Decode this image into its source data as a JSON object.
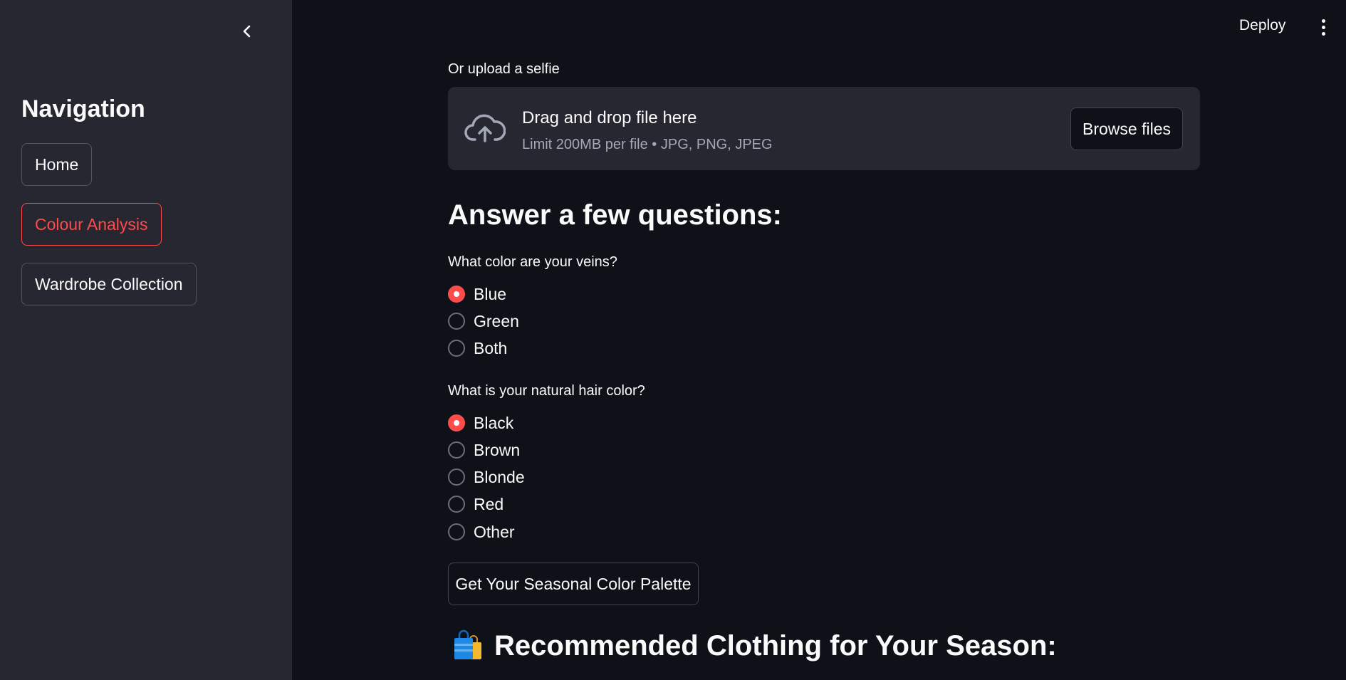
{
  "sidebar": {
    "title": "Navigation",
    "items": [
      {
        "label": "Home",
        "active": false
      },
      {
        "label": "Colour Analysis",
        "active": true
      },
      {
        "label": "Wardrobe Collection",
        "active": false
      }
    ],
    "collapse_icon": "chevron-left-icon"
  },
  "header": {
    "deploy_label": "Deploy",
    "menu_icon": "kebab-menu-icon"
  },
  "upload": {
    "label": "Or upload a selfie",
    "title": "Drag and drop file here",
    "subtitle": "Limit 200MB per file • JPG, PNG, JPEG",
    "browse_label": "Browse files",
    "icon": "cloud-upload-icon"
  },
  "questions": {
    "heading": "Answer a few questions:",
    "veins": {
      "label": "What color are your veins?",
      "options": [
        "Blue",
        "Green",
        "Both"
      ],
      "selected": "Blue"
    },
    "hair": {
      "label": "What is your natural hair color?",
      "options": [
        "Black",
        "Brown",
        "Blonde",
        "Red",
        "Other"
      ],
      "selected": "Black"
    }
  },
  "cta": {
    "label": "Get Your Seasonal Color Palette"
  },
  "recommend": {
    "heading": "Recommended Clothing for Your Season:",
    "icon": "shopping-bags-icon"
  },
  "colors": {
    "accent": "#ff4b4b",
    "sidebar_bg": "#262730",
    "main_bg": "#0e1117"
  }
}
